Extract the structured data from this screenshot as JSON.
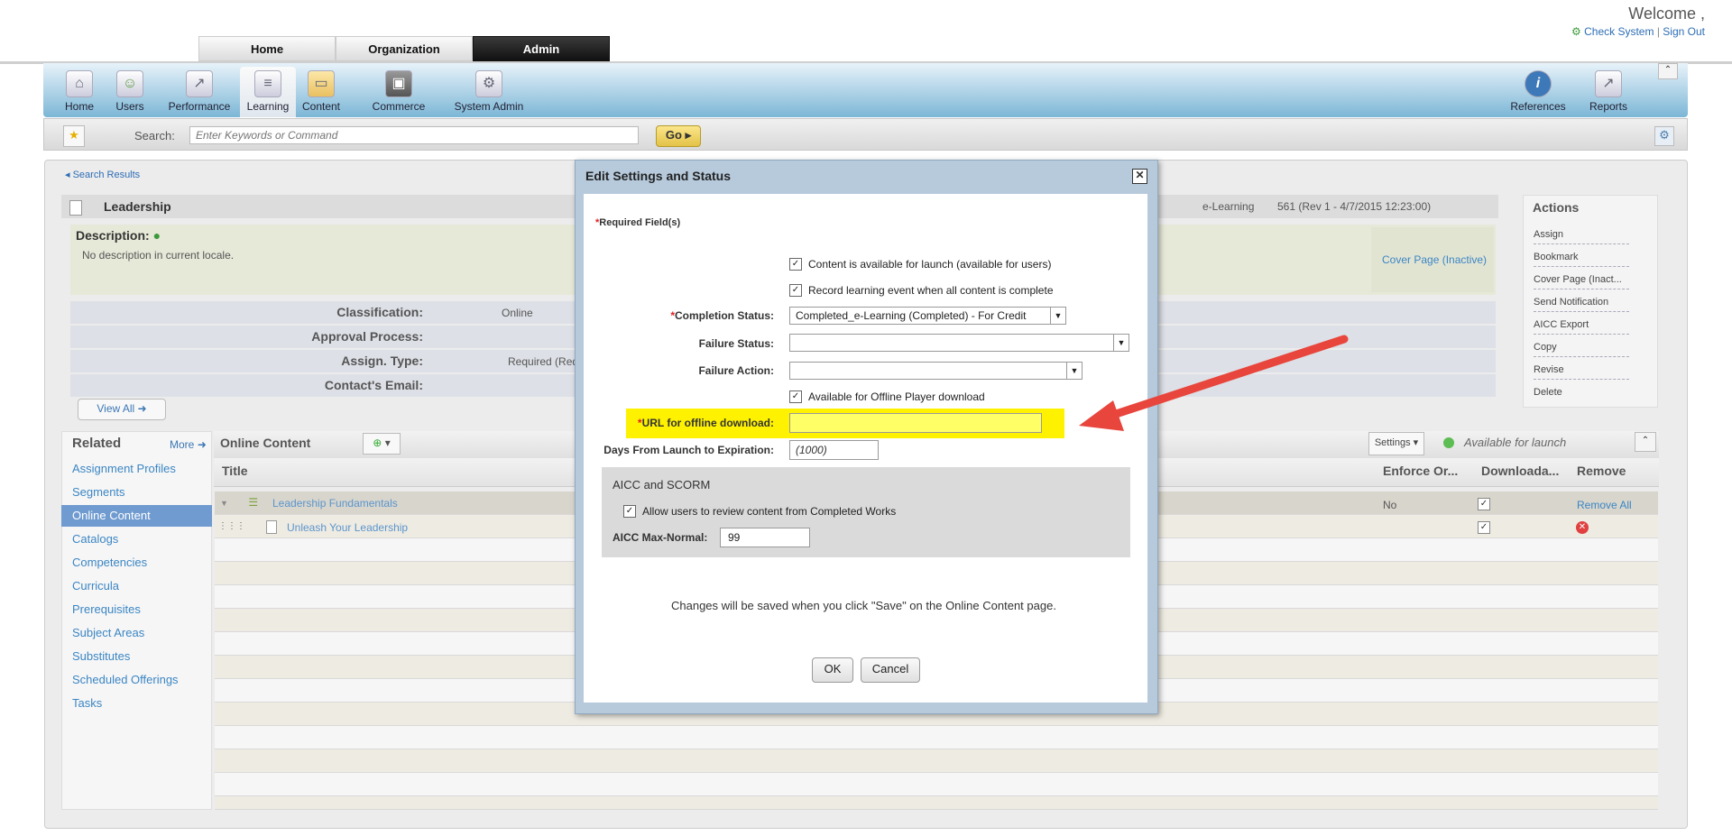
{
  "top": {
    "welcome": "Welcome ,",
    "check_system": "Check System",
    "separator": "|",
    "sign_out": "Sign Out",
    "tabs": [
      "Home",
      "Organization",
      "Admin"
    ]
  },
  "modules": {
    "items": [
      "Home",
      "Users",
      "Performance",
      "Learning",
      "Content",
      "Commerce",
      "System Admin"
    ],
    "right": [
      "References",
      "Reports"
    ]
  },
  "search": {
    "label": "Search:",
    "placeholder": "Enter Keywords or Command",
    "go": "Go"
  },
  "breadcrumb": "Search Results",
  "item": {
    "title": "Leadership",
    "type": "e-Learning",
    "version": "561 (Rev 1 - 4/7/2015 12:23:00)",
    "description_label": "Description:",
    "description": "No description in current locale.",
    "cover_page": "Cover Page (Inactive)"
  },
  "attributes": [
    {
      "label": "Classification:",
      "value": "Online"
    },
    {
      "label": "Approval Process:",
      "value": ""
    },
    {
      "label": "Assign. Type:",
      "value": "Required (Required)"
    },
    {
      "label": "Contact's Email:",
      "value": ""
    }
  ],
  "view_all": "View All",
  "actions": {
    "title": "Actions",
    "items": [
      "Assign",
      "Bookmark",
      "Cover Page (Inact...",
      "Send Notification",
      "AICC Export",
      "Copy",
      "Revise",
      "Delete"
    ]
  },
  "related": {
    "title": "Related",
    "more": "More",
    "items": [
      "Assignment Profiles",
      "Segments",
      "Online Content",
      "Catalogs",
      "Competencies",
      "Curricula",
      "Prerequisites",
      "Subject Areas",
      "Substitutes",
      "Scheduled Offerings",
      "Tasks"
    ]
  },
  "online_content": {
    "title": "Online Content",
    "settings": "Settings",
    "status": "Available for launch",
    "columns": [
      "Title",
      "Enforce Or...",
      "Downloada...",
      "Remove"
    ],
    "rows": [
      {
        "title": "Leadership Fundamentals",
        "enforce": "No",
        "remove": "Remove All"
      },
      {
        "title": "Unleash Your Leadership"
      }
    ]
  },
  "modal": {
    "title": "Edit Settings and Status",
    "required": "Required Field(s)",
    "chk_available": "Content is available for launch (available for users)",
    "chk_record": "Record learning event when all content is complete",
    "completion_label": "Completion Status:",
    "completion_value": "Completed_e-Learning (Completed) - For Credit",
    "failure_status_label": "Failure Status:",
    "failure_action_label": "Failure Action:",
    "chk_offline": "Available for Offline Player download",
    "url_label": "URL for offline download:",
    "url_value": "",
    "expiration_label": "Days From Launch to Expiration:",
    "expiration_placeholder": "(1000)",
    "aicc_title": "AICC and SCORM",
    "chk_review": "Allow users to review content from Completed Works",
    "maxnorm_label": "AICC Max-Normal:",
    "maxnorm_value": "99",
    "save_note": "Changes will be saved when you click \"Save\" on the Online Content page.",
    "ok": "OK",
    "cancel": "Cancel"
  },
  "colors": {
    "annotation_arrow": "#e8453c",
    "highlight": "#fff200",
    "selected_nav": "#6f9bd0"
  }
}
